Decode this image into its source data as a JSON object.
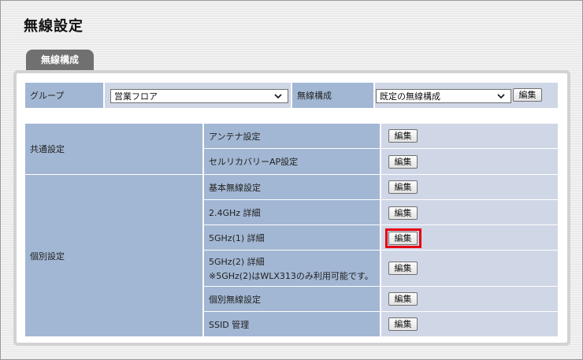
{
  "page_title": "無線設定",
  "tab_label": "無線構成",
  "top_row": {
    "group_label": "グループ",
    "group_value": "営業フロア",
    "wireless_config_label": "無線構成",
    "wireless_config_value": "既定の無線構成",
    "edit_label": "編集"
  },
  "sections": [
    {
      "label": "共通設定",
      "items": [
        {
          "name": "アンテナ設定",
          "button": "編集"
        },
        {
          "name": "セルリカバリーAP設定",
          "button": "編集"
        }
      ]
    },
    {
      "label": "個別設定",
      "items": [
        {
          "name": "基本無線設定",
          "button": "編集"
        },
        {
          "name": "2.4GHz 詳細",
          "button": "編集"
        },
        {
          "name": "5GHz(1) 詳細",
          "button": "編集",
          "highlighted": true
        },
        {
          "name": "5GHz(2) 詳細",
          "note": "※5GHz(2)はWLX313のみ利用可能です。",
          "button": "編集"
        },
        {
          "name": "個別無線設定",
          "button": "編集"
        },
        {
          "name": "SSID 管理",
          "button": "編集"
        }
      ]
    }
  ],
  "colors": {
    "header_cell": "#a2b7d3",
    "value_cell": "#cfd6e6",
    "tab": "#707070",
    "highlight": "#e60012"
  }
}
